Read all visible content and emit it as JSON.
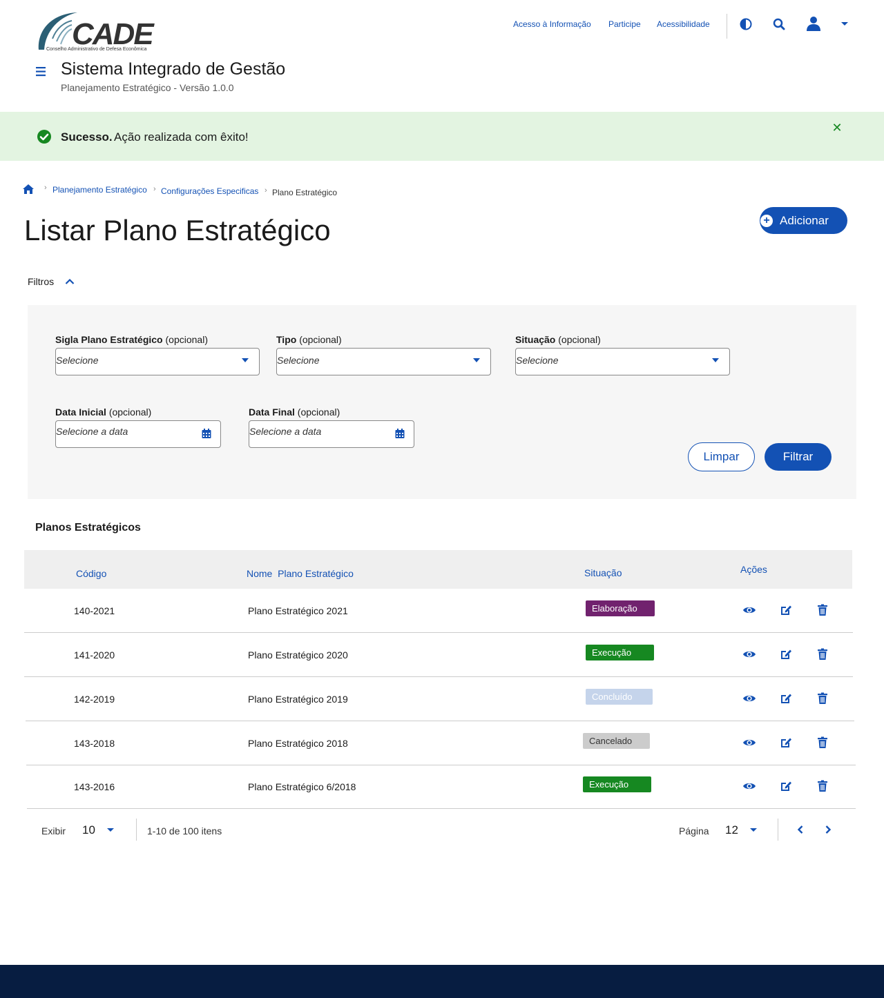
{
  "brand": {
    "logo_text": "CADE",
    "logo_subtitle": "Conselho Administrativo de Defesa Econômica"
  },
  "header": {
    "links": [
      "Acesso à Informação",
      "Participe",
      "Acessibilidade"
    ],
    "system_title": "Sistema Integrado de Gestão",
    "system_subtitle": "Planejamento Estratégico - Versão 1.0.0"
  },
  "alert": {
    "strong": "Sucesso.",
    "message": "Ação realizada com êxito!",
    "color": "#168821"
  },
  "breadcrumb": [
    "Planejamento Estratégico",
    "Configurações Especificas",
    "Plano Estratégico"
  ],
  "page": {
    "title": "Listar Plano Estratégico",
    "add_label": "Adicionar"
  },
  "filters": {
    "toggle_label": "Filtros",
    "fields": {
      "sigla": {
        "label": "Sigla Plano Estratégico",
        "optional": "(opcional)",
        "placeholder": "Selecione"
      },
      "tipo": {
        "label": "Tipo",
        "optional": "(opcional)",
        "placeholder": "Selecione"
      },
      "situacao": {
        "label": "Situação",
        "optional": "(opcional)",
        "placeholder": "Selecione"
      },
      "data_inicial": {
        "label": "Data Inicial",
        "optional": "(opcional)",
        "placeholder": "Selecione a data"
      },
      "data_final": {
        "label": "Data Final",
        "optional": "(opcional)",
        "placeholder": "Selecione a data"
      }
    },
    "clear_label": "Limpar",
    "filter_label": "Filtrar"
  },
  "table": {
    "title": "Planos Estratégicos",
    "headers": {
      "codigo": "Código",
      "nome": "Nome  Plano Estratégico",
      "situacao": "Situação",
      "acoes": "Ações"
    },
    "rows": [
      {
        "codigo": "140-2021",
        "nome": "Plano Estratégico 2021",
        "situacao": "Elaboração",
        "bg": "#71226e",
        "fg": "#ffffff"
      },
      {
        "codigo": "141-2020",
        "nome": "Plano Estratégico 2020",
        "situacao": "Execução",
        "bg": "#168821",
        "fg": "#ffffff"
      },
      {
        "codigo": "142-2019",
        "nome": "Plano Estratégico 2019",
        "situacao": "Concluído",
        "bg": "#c5d4eb",
        "fg": "#ffffff"
      },
      {
        "codigo": "143-2018",
        "nome": "Plano Estratégico 2018",
        "situacao": "Cancelado",
        "bg": "#cccccc",
        "fg": "#333333"
      },
      {
        "codigo": "143-2016",
        "nome": "Plano Estratégico 6/2018",
        "situacao": "Execução",
        "bg": "#168821",
        "fg": "#ffffff"
      }
    ],
    "action_icons": [
      "eye-icon",
      "edit-icon",
      "trash-icon"
    ]
  },
  "pagination": {
    "show_label": "Exibir",
    "per_page": "10",
    "range_text": "1-10 de 100 itens",
    "page_label": "Página",
    "page": "12"
  },
  "colors": {
    "primary": "#1351b4",
    "footer": "#071d41",
    "success_bg": "#e3f4e1"
  }
}
